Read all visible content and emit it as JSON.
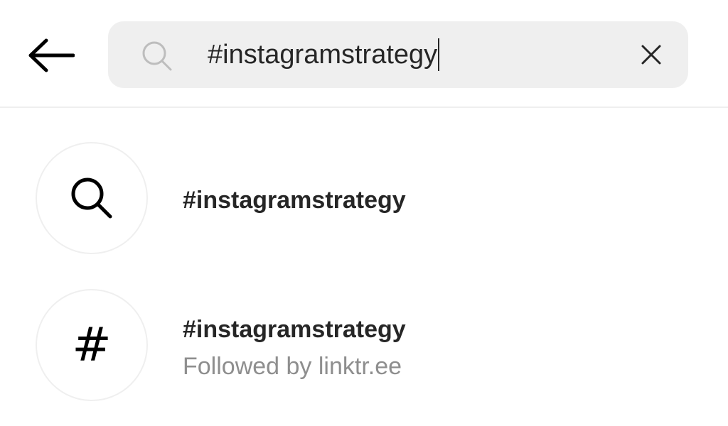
{
  "search": {
    "query": "#instagramstrategy",
    "icon": "search-icon",
    "clear_icon": "close-icon",
    "back_icon": "back-arrow-icon"
  },
  "results": [
    {
      "icon": "search-icon",
      "title": "#instagramstrategy",
      "subtitle": ""
    },
    {
      "icon": "hashtag-icon",
      "icon_glyph": "#",
      "title": "#instagramstrategy",
      "subtitle": "Followed by linktr.ee"
    }
  ],
  "colors": {
    "text_primary": "#262626",
    "text_secondary": "#8e8e8e",
    "search_bg": "#efefef",
    "divider": "#efefef"
  }
}
